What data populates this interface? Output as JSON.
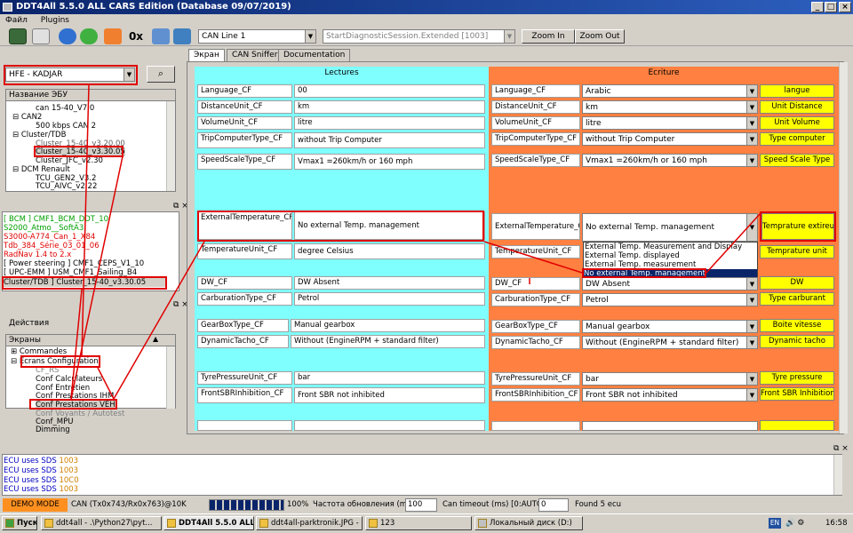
{
  "window": {
    "title": "DDT4All 5.5.0 ALL CARS Edition (Database 09/07/2019)"
  },
  "menu": {
    "file": "Файл",
    "plugins": "Plugins"
  },
  "toolbar": {
    "hex_label": "0x",
    "bus_select": "CAN Line 1",
    "session_select": "StartDiagnosticSession.Extended [1003]",
    "zoom_in": "Zoom In",
    "zoom_out": "Zoom Out"
  },
  "vehicle": {
    "selected": "HFE - KADJAR"
  },
  "ecu_tree": {
    "header": "Название ЭБУ",
    "items": [
      "can 15-40_V7.0",
      "CAN2",
      "500 kbps CAN 2",
      "Cluster/TDB",
      "Cluster_15-40_v3.20.00",
      "Cluster_15-40_v3.30.05",
      "Cluster_JFC_v2.30",
      "DCM Renault",
      "TCU_GEN2_V3.2",
      "TCU_AIVC_v2.22"
    ]
  },
  "ecu_list": [
    {
      "text": "[ BCM ] CMF1_BCM_DDT_10",
      "color": "#00a000"
    },
    {
      "text": "S2000_Atmo__SoftA3",
      "color": "#00a000"
    },
    {
      "text": "S3000-A774_Can_1_X84",
      "color": "#e00000"
    },
    {
      "text": "Tdb_384_Série_03_01_06",
      "color": "#e00000"
    },
    {
      "text": "RadNav 1.4 to 2.x",
      "color": "#e00000"
    },
    {
      "text": "[ Power steering ] CMF1_CEPS_V1_10",
      "color": "#000000"
    },
    {
      "text": "[ UPC-EMM ] USM_CMF1_Sailing_B4",
      "color": "#000000"
    },
    {
      "text": "Cluster/TDB ] Cluster_15-40_v3.30.05",
      "color": "#000000"
    }
  ],
  "actions": {
    "title": "Действия"
  },
  "screens": {
    "header": "Экраны",
    "items": [
      "Commandes",
      "Ecrans Configuration",
      "CF_RS",
      "Conf Calculateurs",
      "Conf Entretien",
      "Conf Prestations IHM",
      "Conf Prestations VEH",
      "Conf Voyants / Autotest",
      "Conf_MPU",
      "Dimming"
    ]
  },
  "tabs": [
    "Экран",
    "CAN Sniffer",
    "Documentation"
  ],
  "lectures": {
    "title": "Lectures",
    "rows": [
      {
        "label": "Language_CF",
        "value": "00"
      },
      {
        "label": "DistanceUnit_CF",
        "value": "km"
      },
      {
        "label": "VolumeUnit_CF",
        "value": "litre"
      },
      {
        "label": "TripComputerType_CF",
        "value": "without Trip Computer"
      },
      {
        "label": "SpeedScaleType_CF",
        "value": "Vmax1 =260km/h or 160 mph"
      },
      {
        "label": "ExternalTemperature_CF",
        "value": "No external Temp. management"
      },
      {
        "label": "TemperatureUnit_CF",
        "value": "degree Celsius"
      },
      {
        "label": "DW_CF",
        "value": "DW Absent"
      },
      {
        "label": "CarburationType_CF",
        "value": "Petrol"
      },
      {
        "label": "GearBoxType_CF",
        "value": "Manual gearbox"
      },
      {
        "label": "DynamicTacho_CF",
        "value": "Without (EngineRPM + standard filter)"
      },
      {
        "label": "TyrePressureUnit_CF",
        "value": "bar"
      },
      {
        "label": "FrontSBRInhibition_CF",
        "value": "Front SBR not inhibited"
      }
    ]
  },
  "ecriture": {
    "title": "Ecriture",
    "rows": [
      {
        "label": "Language_CF",
        "value": "Arabic",
        "button": "langue"
      },
      {
        "label": "DistanceUnit_CF",
        "value": "km",
        "button": "Unit Distance"
      },
      {
        "label": "VolumeUnit_CF",
        "value": "litre",
        "button": "Unit Volume"
      },
      {
        "label": "TripComputerType_CF",
        "value": "without Trip Computer",
        "button": "Type computer"
      },
      {
        "label": "SpeedScaleType_CF",
        "value": "Vmax1 =260km/h or 160 mph",
        "button": "Speed Scale Type"
      },
      {
        "label": "ExternalTemperature_CF",
        "value": "No external Temp. management",
        "button": "Temprature extireure"
      },
      {
        "label": "TemperatureUnit_CF",
        "value": "",
        "button": "Temprature unit"
      },
      {
        "label": "DW_CF",
        "value": "DW Absent",
        "button": "DW"
      },
      {
        "label": "CarburationType_CF",
        "value": "Petrol",
        "button": "Type carburant"
      },
      {
        "label": "GearBoxType_CF",
        "value": "Manual gearbox",
        "button": "Boite vitesse"
      },
      {
        "label": "DynamicTacho_CF",
        "value": "Without (EngineRPM + standard filter)",
        "button": "Dynamic tacho"
      },
      {
        "label": "TyrePressureUnit_CF",
        "value": "bar",
        "button": "Tyre pressure"
      },
      {
        "label": "FrontSBRInhibition_CF",
        "value": "Front SBR not inhibited",
        "button": "Front SBR Inhibition"
      }
    ],
    "dropdown_options": [
      "External Temp. Measurement and Display",
      "External Temp. displayed",
      "External Temp. measurement",
      "No external Temp. management"
    ]
  },
  "log": {
    "lines": [
      {
        "prefix": "ECU uses SDS",
        "code": "1003"
      },
      {
        "prefix": "ECU uses SDS",
        "code": "1003"
      },
      {
        "prefix": "ECU uses SDS",
        "code": "10C0"
      },
      {
        "prefix": "ECU uses SDS",
        "code": "1003"
      }
    ]
  },
  "status": {
    "mode": "DEMO MODE",
    "can": "CAN (Tx0x743/Rx0x763)@10K",
    "progress_pct": "100%",
    "refresh_label": "Частота обновления (ms):",
    "refresh_value": "100",
    "timeout_label": "Can timeout (ms) [0:AUTO] :",
    "timeout_value": "0",
    "found": "Found 5 ecu"
  },
  "taskbar": {
    "start": "Пуск",
    "tasks": [
      "ddt4all - .\\Python27\\pyt...",
      "DDT4All 5.5.0 ALL CAR...",
      "ddt4all-parktronik.JPG - ...",
      "123",
      "Локальный диск (D:)"
    ],
    "lang": "EN",
    "clock": "16:58"
  },
  "colors": {
    "lectures_bg": "#80ffff",
    "ecriture_bg": "#ff8040",
    "write_button": "#ffff00",
    "highlight": "#e00000"
  }
}
